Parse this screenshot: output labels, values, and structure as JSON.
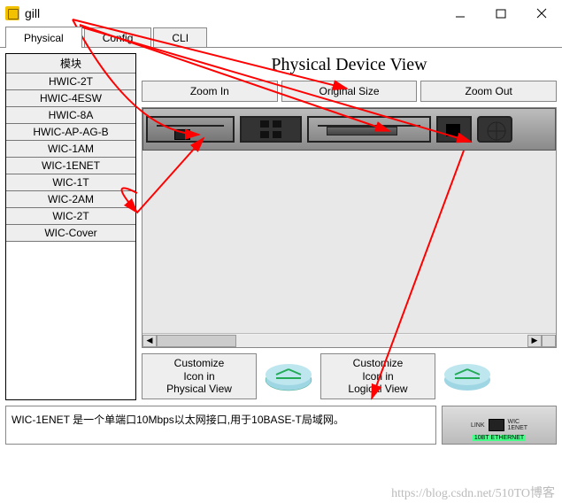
{
  "window": {
    "title": "gill",
    "minimize_icon": "minimize",
    "maximize_icon": "maximize",
    "close_icon": "close"
  },
  "tabs": [
    {
      "label": "Physical",
      "active": true
    },
    {
      "label": "Config",
      "active": false
    },
    {
      "label": "CLI",
      "active": false
    }
  ],
  "modules_header": "模块",
  "modules": [
    "HWIC-2T",
    "HWIC-4ESW",
    "HWIC-8A",
    "HWIC-AP-AG-B",
    "WIC-1AM",
    "WIC-1ENET",
    "WIC-1T",
    "WIC-2AM",
    "WIC-2T",
    "WIC-Cover"
  ],
  "physical_view": {
    "title": "Physical Device View",
    "zoom_in": "Zoom In",
    "original_size": "Original Size",
    "zoom_out": "Zoom Out"
  },
  "customize": {
    "physical": "Customize\nIcon in\nPhysical View",
    "logical": "Customize\nIcon in\nLogical View"
  },
  "description": "WIC-1ENET 是一个单端口10Mbps以太网接口,用于10BASE-T局域网。",
  "preview": {
    "link": "LINK",
    "label": "WIC\n1ENET",
    "tag": "10BT ETHERNET"
  },
  "watermark": "https://blog.csdn.net/510TO博客"
}
